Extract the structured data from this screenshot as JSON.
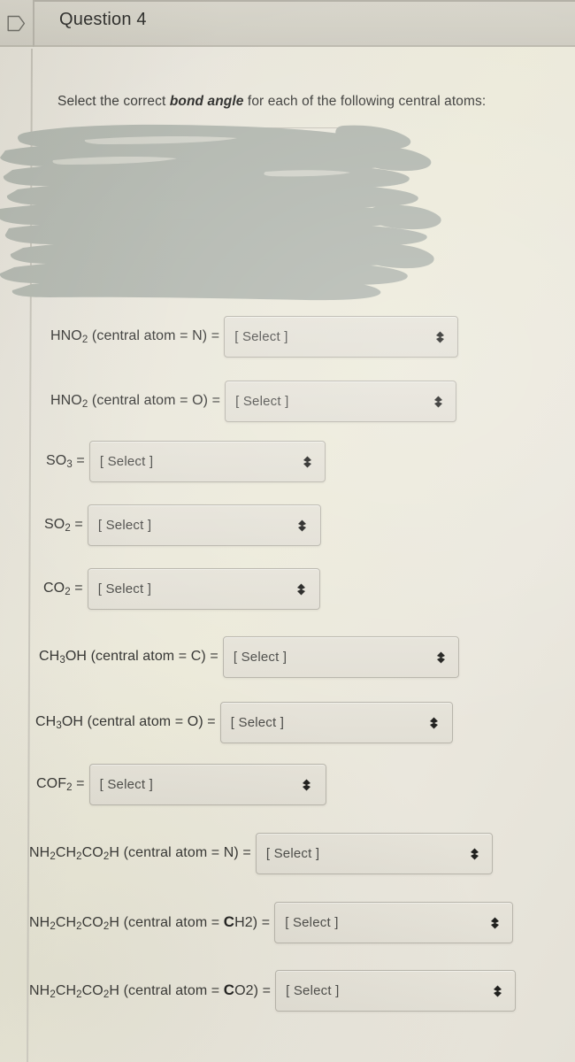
{
  "header": {
    "title": "Question 4",
    "flag_icon": "flag-outline-icon"
  },
  "prompt": {
    "before": "Select the correct ",
    "emphasis": "bond angle",
    "after": " for each of the following central atoms:"
  },
  "redaction": {
    "label": "redacted-scribble",
    "color": "#b0b5ad"
  },
  "select_placeholder": "[ Select ]",
  "dropdown_icon": "chevron-up-down-icon",
  "rows": [
    {
      "id": "hno2-n",
      "label_html": "HNO<sub>2</sub> (central atom = N) =",
      "label_text": "HNO2 (central atom = N) =",
      "value": "[ Select ]"
    },
    {
      "id": "hno2-o",
      "label_html": "HNO<sub>2</sub> (central atom = O) =",
      "label_text": "HNO2 (central atom = O) =",
      "value": "[ Select ]"
    },
    {
      "id": "so3",
      "label_html": "SO<sub>3</sub> =",
      "label_text": "SO3 =",
      "value": "[ Select ]"
    },
    {
      "id": "so2",
      "label_html": "SO<sub>2</sub> =",
      "label_text": "SO2 =",
      "value": "[ Select ]"
    },
    {
      "id": "co2",
      "label_html": "CO<sub>2</sub> =",
      "label_text": "CO2 =",
      "value": "[ Select ]"
    },
    {
      "id": "ch3oh-c",
      "label_html": "CH<sub>3</sub>OH (central atom = C) =",
      "label_text": "CH3OH (central atom = C) =",
      "value": "[ Select ]"
    },
    {
      "id": "ch3oh-o",
      "label_html": "CH<sub>3</sub>OH (central atom = O) =",
      "label_text": "CH3OH (central atom = O) =",
      "value": "[ Select ]"
    },
    {
      "id": "cof2",
      "label_html": "COF<sub>2</sub> =",
      "label_text": "COF2 =",
      "value": "[ Select ]"
    },
    {
      "id": "glycine-n",
      "label_html": "NH<sub>2</sub>CH<sub>2</sub>CO<sub>2</sub>H (central atom = N) =",
      "label_text": "NH2CH2CO2H (central atom = N) =",
      "value": "[ Select ]"
    },
    {
      "id": "glycine-ch2",
      "label_html": "NH<sub>2</sub>CH<sub>2</sub>CO<sub>2</sub>H (central atom = <span class=\"bigc\">C</span>H2) =",
      "label_text": "NH2CH2CO2H (central atom = CH2) =",
      "value": "[ Select ]"
    },
    {
      "id": "glycine-co2",
      "label_html": "NH<sub>2</sub>CH<sub>2</sub>CO<sub>2</sub>H (central atom = <span class=\"bigc\">C</span>O2) =",
      "label_text": "NH2CH2CO2H (central atom = CO2) =",
      "value": "[ Select ]"
    }
  ],
  "layout": {
    "row_tops": [
      357,
      430,
      498,
      570,
      642,
      719,
      793,
      863,
      941,
      1019,
      1096
    ],
    "row_lefts": [
      57,
      57,
      52,
      50,
      49,
      44,
      40,
      41,
      33,
      33,
      33
    ],
    "select_widths": [
      265,
      262,
      267,
      264,
      263,
      267,
      263,
      268,
      268,
      270,
      272
    ]
  }
}
